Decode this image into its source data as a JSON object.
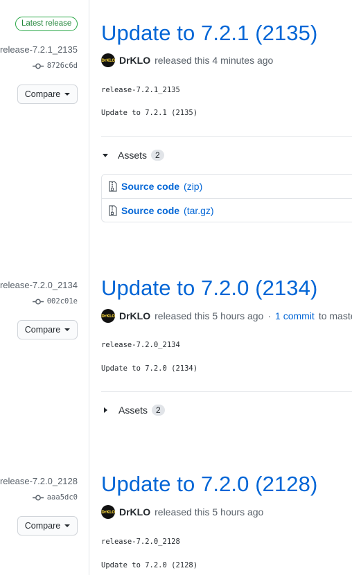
{
  "releases": [
    {
      "latest_badge": "Latest release",
      "tag": "release-7.2.1_2135",
      "commit_sha": "8726c6d",
      "compare_label": "Compare",
      "title": "Update to 7.2.1 (2135)",
      "avatar_text": "DrKLO",
      "author": "DrKLO",
      "released_text": "released this 4 minutes ago",
      "body_tag": "release-7.2.1_2135",
      "body_text": "Update to 7.2.1 (2135)",
      "assets_label": "Assets",
      "assets_count": "2",
      "assets": [
        {
          "name": "Source code",
          "ext": "(zip)"
        },
        {
          "name": "Source code",
          "ext": "(tar.gz)"
        }
      ]
    },
    {
      "tag": "release-7.2.0_2134",
      "commit_sha": "002c01e",
      "compare_label": "Compare",
      "title": "Update to 7.2.0 (2134)",
      "avatar_text": "DrKLO",
      "author": "DrKLO",
      "released_text": "released this 5 hours ago",
      "sep": "·",
      "commit_link": "1 commit",
      "to_master": "to master s",
      "body_tag": "release-7.2.0_2134",
      "body_text": "Update to 7.2.0 (2134)",
      "assets_label": "Assets",
      "assets_count": "2"
    },
    {
      "tag": "release-7.2.0_2128",
      "commit_sha": "aaa5dc0",
      "compare_label": "Compare",
      "title": "Update to 7.2.0 (2128)",
      "avatar_text": "DrKLO",
      "author": "DrKLO",
      "released_text": "released this 5 hours ago",
      "body_tag": "release-7.2.0_2128",
      "body_text": "Update to 7.2.0 (2128)"
    }
  ]
}
